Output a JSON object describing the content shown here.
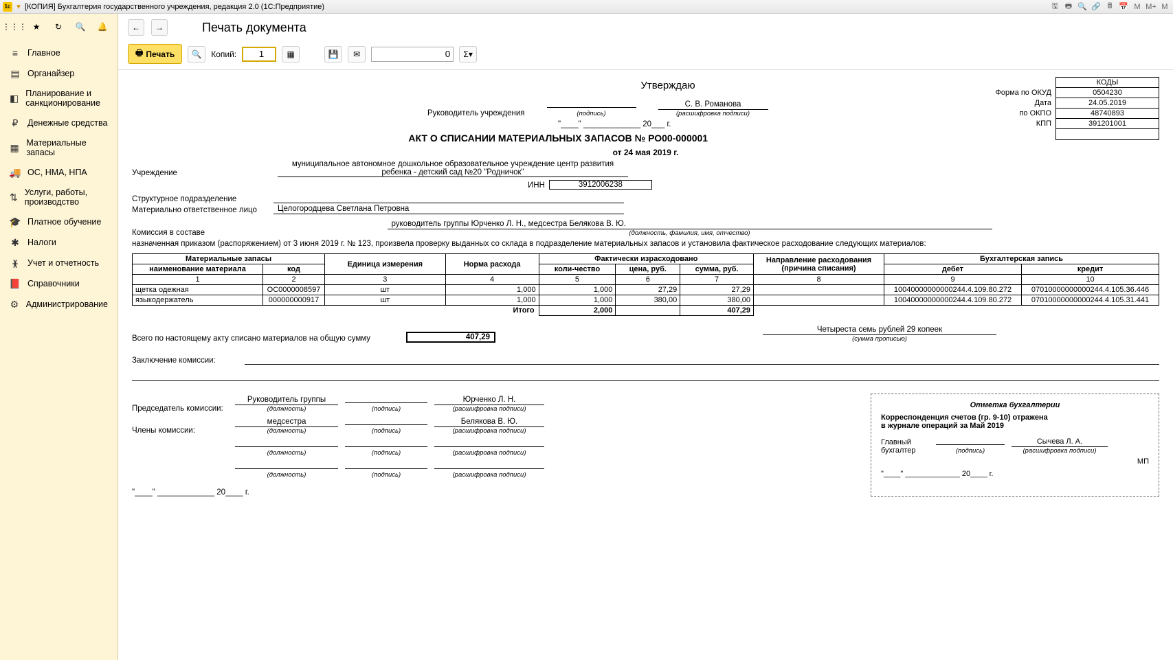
{
  "window": {
    "title": "[КОПИЯ] Бухгалтерия государственного учреждения, редакция 2.0 (1С:Предприятие)"
  },
  "sidebar": {
    "items": [
      {
        "label": "Главное",
        "icon": "≡"
      },
      {
        "label": "Органайзер",
        "icon": "▤"
      },
      {
        "label": "Планирование и санкционирование",
        "icon": "◧"
      },
      {
        "label": "Денежные средства",
        "icon": "₽"
      },
      {
        "label": "Материальные запасы",
        "icon": "▦"
      },
      {
        "label": "ОС, НМА, НПА",
        "icon": "🚚"
      },
      {
        "label": "Услуги, работы, производство",
        "icon": "⇅"
      },
      {
        "label": "Платное обучение",
        "icon": "🎓"
      },
      {
        "label": "Налоги",
        "icon": "✱"
      },
      {
        "label": "Учет и отчетность",
        "icon": "ᚕ"
      },
      {
        "label": "Справочники",
        "icon": "📕"
      },
      {
        "label": "Администрирование",
        "icon": "⚙"
      }
    ]
  },
  "page": {
    "title": "Печать документа"
  },
  "toolbar": {
    "print": "Печать",
    "copies_label": "Копий:",
    "copies_value": "1",
    "num_value": "0",
    "sigma": "Σ"
  },
  "doc": {
    "approve": "Утверждаю",
    "head_label": "Руководитель учреждения",
    "podpis": "(подпись)",
    "rasshifr": "(расшифровка подписи)",
    "head_name": "С. В. Романова",
    "date_quotes": "\"____\" _____________ 20___ г.",
    "act_title": "АКТ О СПИСАНИИ МАТЕРИАЛЬНЫХ ЗАПАСОВ  № РО00-000001",
    "act_date": "от 24 мая 2019 г.",
    "org_label": "Учреждение",
    "org_name": "муниципальное автономное дошкольное образовательное учреждение центр развития ребенка - детский сад №20 \"Родничок\"",
    "inn_label": "ИНН",
    "inn": "3912006238",
    "kpp_label": "КПП",
    "kpp": "391201001",
    "codes_header": "КОДЫ",
    "form_okud_label": "Форма  по ОКУД",
    "form_okud": "0504230",
    "date_label": "Дата",
    "date": "24.05.2019",
    "okpo_label": "по ОКПО",
    "okpo": "48740893",
    "struct_label": "Структурное подразделение",
    "mol_label": "Материально ответственное лицо",
    "mol": "Целогородцева Светлана Петровна",
    "comm_label": "Комиссия в составе",
    "comm_members": "руководитель группы Юрченко Л. Н., медсестра Белякова  В. Ю.",
    "comm_hint": "(должность, фамилия, имя, отчество)",
    "order_text": "назначенная приказом (распоряжением)  от  3 июня 2019 г. №  123, произвела проверку выданных со склада в подразделение материальных запасов и установила фактическое расходование следующих материалов:",
    "table": {
      "h_mat": "Материальные запасы",
      "h_name": "наименование материала",
      "h_code": "код",
      "h_unit": "Едини­ца изме­рения",
      "h_norm": "Норма расхода",
      "h_fact": "Фактически израсходовано",
      "h_qty": "коли-чество",
      "h_price": "цена, руб.",
      "h_sum": "сумма, руб.",
      "h_dir": "Направление расходования (причина списания)",
      "h_acc": "Бухгалтерская запись",
      "h_debit": "дебет",
      "h_credit": "кредит",
      "cols": [
        "1",
        "2",
        "3",
        "4",
        "5",
        "6",
        "7",
        "8",
        "9",
        "10"
      ],
      "rows": [
        {
          "name": "щетка одежная",
          "code": "ОС0000008597",
          "unit": "шт",
          "norm": "1,000",
          "qty": "1,000",
          "price": "27,29",
          "sum": "27,29",
          "dir": "",
          "debit": "10040000000000244.4.109.80.272",
          "credit": "07010000000000244.4.105.36.446"
        },
        {
          "name": "языкодержатель",
          "code": "000000000917",
          "unit": "шт",
          "norm": "1,000",
          "qty": "1,000",
          "price": "380,00",
          "sum": "380,00",
          "dir": "",
          "debit": "10040000000000244.4.109.80.272",
          "credit": "07010000000000244.4.105.31.441"
        }
      ],
      "total_label": "Итого",
      "total_qty": "2,000",
      "total_sum": "407,29"
    },
    "total_text": "Всего по настоящему акту списано материалов на общую сумму",
    "total_num": "407,29",
    "total_words": "Четыреста семь рублей 29 копеек",
    "total_words_hint": "(сумма прописью)",
    "concl_label": "Заключение комиссии:",
    "chairman_label": "Председатель комиссии:",
    "chairman_pos": "Руководитель группы",
    "chairman_name": "Юрченко Л. Н.",
    "members_label": "Члены комиссии:",
    "member1_pos": "медсестра",
    "member1_name": "Белякова  В. Ю.",
    "pos_hint": "(должность)",
    "acct": {
      "title": "Отметка бухгалтерии",
      "line1": "Корреспонденция счетов (гр. 9-10) отражена",
      "line2": "в журнале операций за Май 2019",
      "chief_label": "Главный бухгалтер",
      "chief_name": "Сычева Л. А.",
      "mp": "МП",
      "date_tpl": "\"____\" _____________ 20____ г."
    },
    "bottom_date": "\"____\" _____________ 20____ г."
  }
}
